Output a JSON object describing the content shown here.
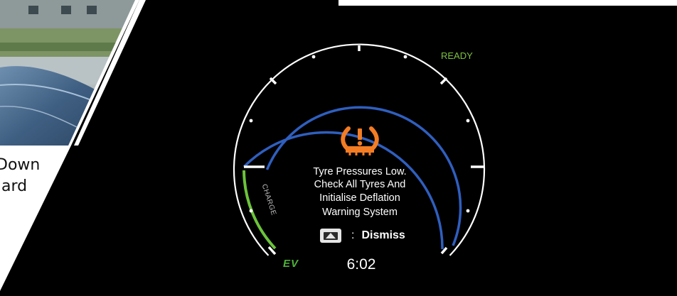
{
  "caption": {
    "line1": "Down",
    "line2": "ard"
  },
  "dashboard": {
    "status_label": "READY",
    "mode_label": "EV",
    "gauge_label": "CHARGE",
    "warning_icon": "tyre-pressure-warning-icon",
    "warning_lines": [
      "Tyre Pressures Low.",
      "Check All Tyres And",
      "Initialise Deflation",
      "Warning System"
    ],
    "dismiss_separator": ":",
    "dismiss_label": "Dismiss",
    "dismiss_icon": "steering-button-up-icon",
    "clock": "6:02",
    "colors": {
      "gauge_blue": "#2f5fbf",
      "charge_green": "#6cc33b",
      "warning_orange": "#f37c24",
      "ready_green": "#7cc241"
    }
  }
}
